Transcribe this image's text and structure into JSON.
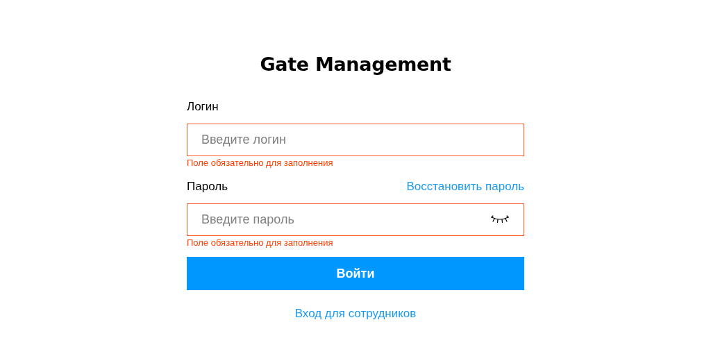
{
  "title": "Gate Management",
  "fields": [
    {
      "kind": "text",
      "label": "Логин",
      "placeholder": "Введите логин",
      "invalid": true,
      "error": "Поле обязательно для заполнения"
    },
    {
      "kind": "password",
      "label": "Пароль",
      "link": "Восстановить пароль",
      "placeholder": "Введите пароль",
      "invalid": true,
      "error": "Поле обязательно для заполнения"
    }
  ],
  "submit_button": "Войти",
  "staff_link": "Вход для сотрудников"
}
